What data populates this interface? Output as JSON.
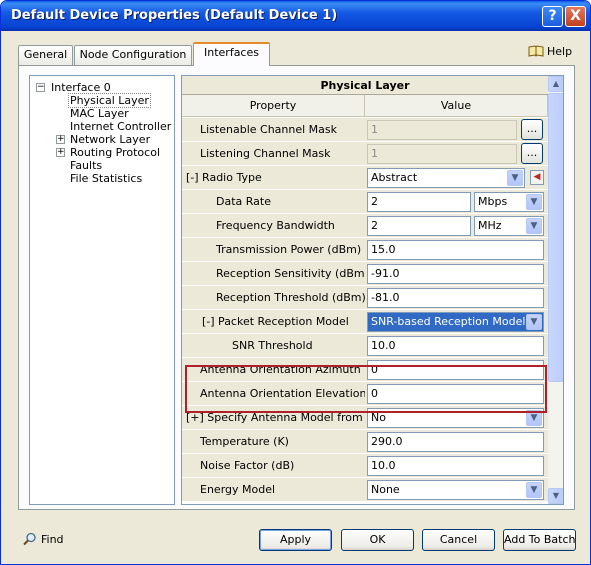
{
  "window": {
    "title": "Default Device Properties (Default Device 1)"
  },
  "titlebar_buttons": {
    "help": "?",
    "close": "X"
  },
  "tabs": [
    {
      "label": "General"
    },
    {
      "label": "Node Configuration"
    },
    {
      "label": "Interfaces"
    }
  ],
  "help_link": "Help",
  "tree": {
    "root": "Interface 0",
    "items": [
      {
        "label": "Physical Layer"
      },
      {
        "label": "MAC Layer"
      },
      {
        "label": "Internet Controller"
      },
      {
        "label": "Network Layer"
      },
      {
        "label": "Routing Protocol"
      },
      {
        "label": "Faults"
      },
      {
        "label": "File Statistics"
      }
    ]
  },
  "grid": {
    "title": "Physical Layer",
    "col_property": "Property",
    "col_value": "Value",
    "rows": [
      {
        "prop": "Listenable Channel Mask",
        "value": "1"
      },
      {
        "prop": "Listening Channel Mask",
        "value": "1"
      },
      {
        "prop": "[-] Radio Type",
        "value": "Abstract"
      },
      {
        "prop": "Data Rate",
        "value": "2",
        "unit": "Mbps"
      },
      {
        "prop": "Frequency Bandwidth",
        "value": "2",
        "unit": "MHz"
      },
      {
        "prop": "Transmission Power (dBm)",
        "value": "15.0"
      },
      {
        "prop": "Reception Sensitivity (dBm)",
        "value": "-91.0"
      },
      {
        "prop": "Reception Threshold (dBm)",
        "value": "-81.0"
      },
      {
        "prop": "[-] Packet Reception Model",
        "value": "SNR-based Reception Model"
      },
      {
        "prop": "SNR Threshold",
        "value": "10.0"
      },
      {
        "prop": "Antenna Orientation Azimuth",
        "value": "0"
      },
      {
        "prop": "Antenna Orientation Elevation",
        "value": "0"
      },
      {
        "prop": "[+] Specify Antenna Model from File",
        "value": "No"
      },
      {
        "prop": "Temperature (K)",
        "value": "290.0"
      },
      {
        "prop": "Noise Factor (dB)",
        "value": "10.0"
      },
      {
        "prop": "Energy Model",
        "value": "None"
      }
    ],
    "ellipsis": "..."
  },
  "footer": {
    "find": "Find",
    "apply": "Apply",
    "ok": "OK",
    "cancel": "Cancel",
    "add_to_batch": "Add To Batch"
  },
  "colors": {
    "highlight_border": "#b0202a",
    "title_bar": "#0642d0"
  }
}
